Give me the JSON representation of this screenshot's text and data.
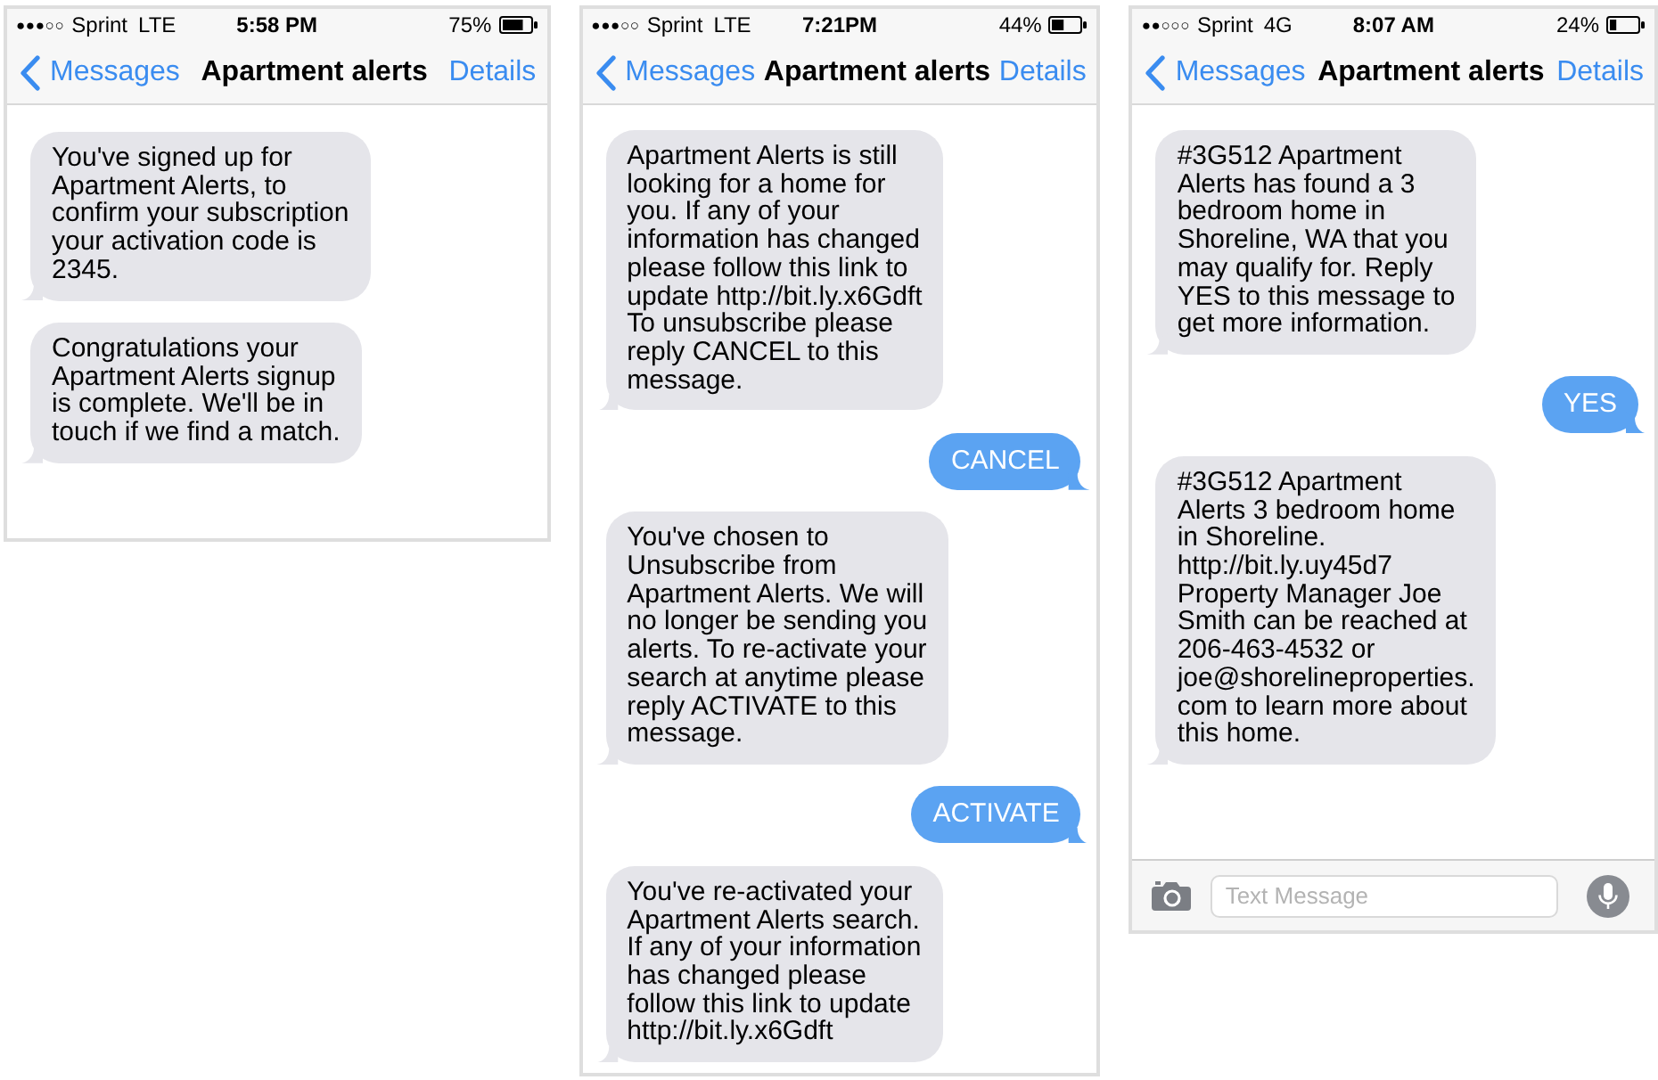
{
  "phones": [
    {
      "status_bar": {
        "signal": "●●●○○",
        "carrier": "Sprint",
        "network": "LTE",
        "time": "5:58 PM",
        "battery": "75%"
      },
      "nav_bar": {
        "back": "Messages",
        "title": "Apartment alerts",
        "action": "Details"
      },
      "messages": [
        {
          "kind": "incoming",
          "text": "You've signed up for\nApartment Alerts, to\nconfirm your subscription\nyour activation code is\n2345."
        },
        {
          "kind": "incoming",
          "text": "Congratulations your\nApartment Alerts signup\nis complete. We'll be in\ntouch if we find a match."
        }
      ]
    },
    {
      "status_bar": {
        "signal": "●●●○○",
        "carrier": "Sprint",
        "network": "LTE",
        "time": "7:21PM",
        "battery": "44%"
      },
      "nav_bar": {
        "back": "Messages",
        "title": "Apartment alerts",
        "action": "Details"
      },
      "messages": [
        {
          "kind": "incoming",
          "text": "Apartment Alerts is still\nlooking for a home for\nyou. If any of your\ninformation has changed\nplease follow this link to\nupdate http://bit.ly.x6Gdft\nTo unsubscribe please\nreply CANCEL to this\nmessage."
        },
        {
          "kind": "outgoing",
          "text": "CANCEL"
        },
        {
          "kind": "incoming",
          "text": "You've chosen to\nUnsubscribe from\nApartment Alerts. We will\nno longer be sending you\nalerts. To re-activate your\nsearch at anytime please\nreply ACTIVATE to this\nmessage."
        },
        {
          "kind": "outgoing",
          "text": "ACTIVATE"
        },
        {
          "kind": "incoming",
          "text": "You've re-activated your\nApartment Alerts search.\nIf any of your information\nhas changed please\nfollow this link to update\nhttp://bit.ly.x6Gdft"
        }
      ]
    },
    {
      "status_bar": {
        "signal": "●●○○○",
        "carrier": "Sprint",
        "network": "4G",
        "time": "8:07 AM",
        "battery": "24%"
      },
      "nav_bar": {
        "back": "Messages",
        "title": "Apartment alerts",
        "action": "Details"
      },
      "messages": [
        {
          "kind": "incoming",
          "text": "#3G512 Apartment\nAlerts has found a 3\nbedroom home in\nShoreline, WA that you\nmay qualify for. Reply\nYES to this message to\nget more information."
        },
        {
          "kind": "outgoing",
          "text": "YES"
        },
        {
          "kind": "incoming",
          "text": "#3G512 Apartment\nAlerts 3 bedroom home\nin Shoreline.\nhttp://bit.ly.uy45d7\nProperty Manager Joe\nSmith can be reached at\n206-463-4532 or\njoe@shorelineproperties.\ncom to learn more about\nthis home."
        }
      ],
      "composer": {
        "placeholder": "Text Message"
      }
    }
  ]
}
